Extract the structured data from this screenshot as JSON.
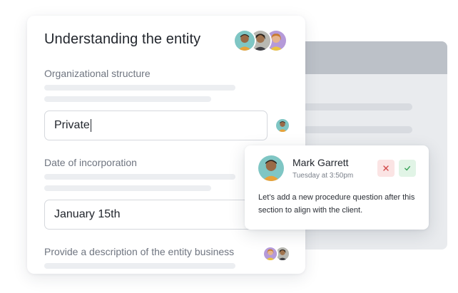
{
  "form": {
    "title": "Understanding the entity",
    "fields": [
      {
        "label": "Organizational structure",
        "value": "Private"
      },
      {
        "label": "Date of incorporation",
        "value": "January 15th"
      },
      {
        "label": "Provide a description of the entity business"
      }
    ]
  },
  "comment": {
    "author": "Mark Garrett",
    "time": "Tuesday at 3:50pm",
    "text": "Let’s add a new procedure question after this section to align with the client.",
    "reject_icon": "x-icon",
    "accept_icon": "check-icon"
  },
  "colors": {
    "reject": "#d24a4a",
    "accept": "#3aa35a",
    "avatar_teal": "#7fc6c4",
    "avatar_purple": "#b59ad9",
    "avatar_gold": "#e4b54a"
  }
}
